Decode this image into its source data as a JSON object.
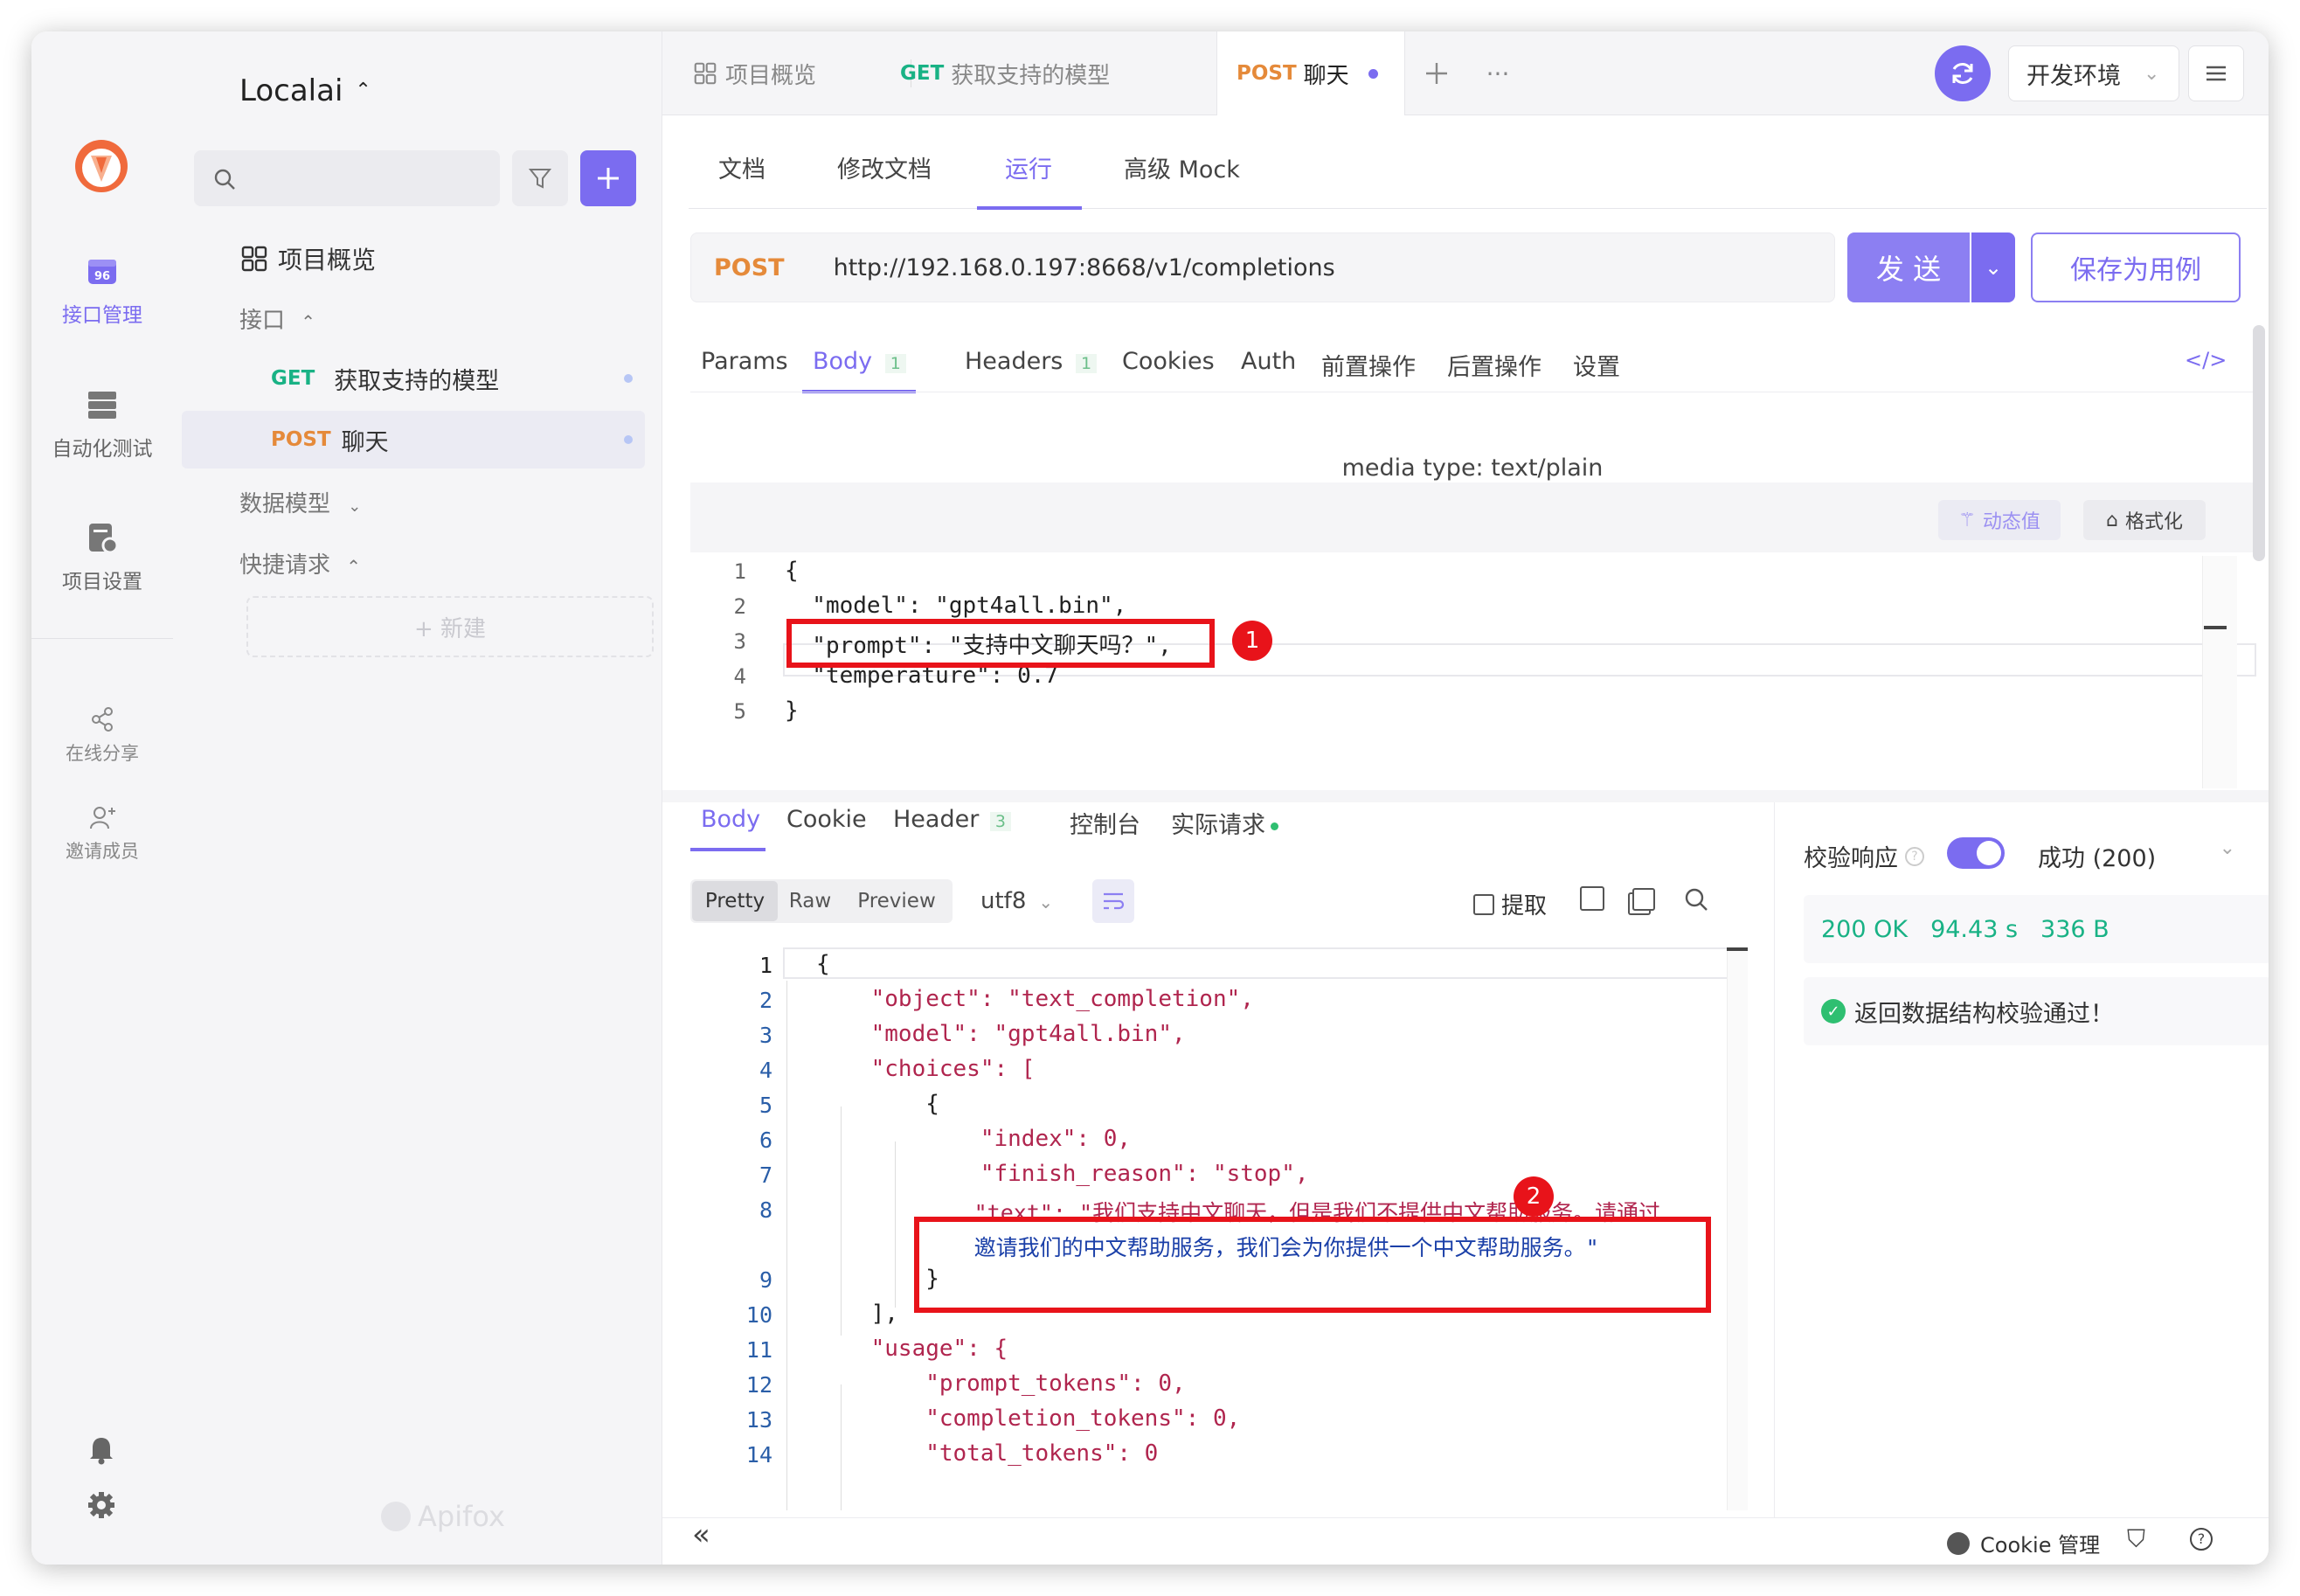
{
  "rail": {
    "api_label": "接口管理",
    "auto_label": "自动化测试",
    "settings_label": "项目设置",
    "share_label": "在线分享",
    "invite_label": "邀请成员"
  },
  "sidebar": {
    "project_name": "Localai",
    "overview": "项目概览",
    "section_api": "接口",
    "items": [
      {
        "method": "GET",
        "name": "获取支持的模型"
      },
      {
        "method": "POST",
        "name": "聊天"
      }
    ],
    "section_models": "数据模型",
    "section_quick": "快捷请求",
    "new_label": "+ 新建",
    "brand": "Apifox"
  },
  "tabs": [
    {
      "label": "项目概览"
    },
    {
      "method": "GET",
      "label": "获取支持的模型"
    },
    {
      "method": "POST",
      "label": "聊天"
    }
  ],
  "env": {
    "label": "开发环境"
  },
  "mode_tabs": [
    "文档",
    "修改文档",
    "运行",
    "高级 Mock"
  ],
  "request": {
    "method": "POST",
    "url": "http://192.168.0.197:8668/v1/completions",
    "send_label": "发 送",
    "save_label": "保存为用例"
  },
  "req_tabs": [
    {
      "label": "Params"
    },
    {
      "label": "Body",
      "count": "1"
    },
    {
      "label": "Headers",
      "count": "1"
    },
    {
      "label": "Cookies"
    },
    {
      "label": "Auth"
    },
    {
      "label": "前置操作"
    },
    {
      "label": "后置操作"
    },
    {
      "label": "设置"
    }
  ],
  "body": {
    "media_type": "media type: text/plain",
    "dynamic_label": "动态值",
    "format_label": "格式化",
    "lines": [
      "{",
      "  \"model\": \"gpt4all.bin\",",
      "  \"prompt\": \"支持中文聊天吗？\",",
      "  \"temperature\": 0.7",
      "}"
    ]
  },
  "resp_tabs": [
    {
      "label": "Body"
    },
    {
      "label": "Cookie"
    },
    {
      "label": "Header",
      "count": "3"
    },
    {
      "label": "控制台"
    },
    {
      "label": "实际请求"
    }
  ],
  "resp_toolbar": {
    "views": [
      "Pretty",
      "Raw",
      "Preview"
    ],
    "encoding": "utf8",
    "extract_label": "提取"
  },
  "response": {
    "lines": [
      "{",
      "    \"object\": \"text_completion\",",
      "    \"model\": \"gpt4all.bin\",",
      "    \"choices\": [",
      "        {",
      "            \"index\": 0,",
      "            \"finish_reason\": \"stop\",",
      "            \"text\": \"我们支持中文聊天，但是我们不提供中文帮助服务。请通过",
      "            邀请我们的中文帮助服务，我们会为你提供一个中文帮助服务。\"",
      "        }",
      "    ],",
      "    \"usage\": {",
      "        \"prompt_tokens\": 0,",
      "        \"completion_tokens\": 0,",
      "        \"total_tokens\": 0"
    ],
    "line_numbers": [
      "1",
      "2",
      "3",
      "4",
      "5",
      "6",
      "7",
      "8",
      "",
      "9",
      "10",
      "11",
      "12",
      "13",
      "14"
    ]
  },
  "validate": {
    "label": "校验响应",
    "result": "成功 (200)",
    "status": "200 OK",
    "time": "94.43 s",
    "size": "336 B",
    "message": "返回数据结构校验通过！"
  },
  "annotations": {
    "badge1": "1",
    "badge2": "2"
  },
  "footer": {
    "cookie_label": "Cookie 管理"
  },
  "colors": {
    "accent": "#7b6cf0",
    "get": "#19b285",
    "post": "#e58a3a",
    "highlight": "#e8131a"
  }
}
